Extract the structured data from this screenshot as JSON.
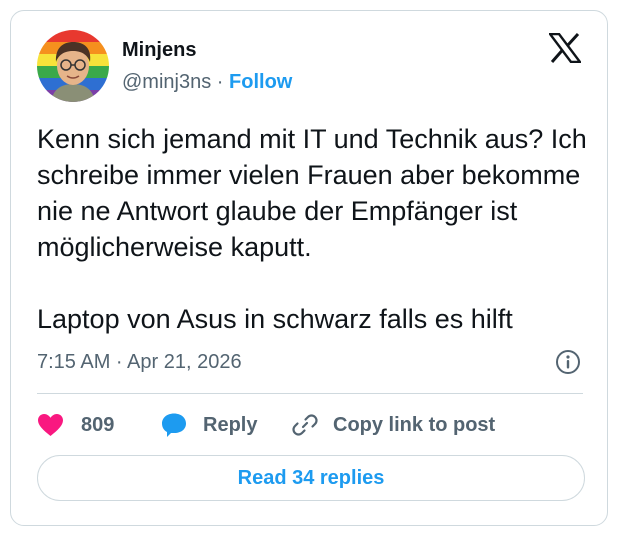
{
  "author": {
    "name": "Minjens",
    "handle": "@minj3ns",
    "separator": "·",
    "follow_label": "Follow"
  },
  "tweet": {
    "text": "Kenn sich jemand mit IT und Technik aus? Ich schreibe immer vielen Frauen aber bekomme nie ne Antwort glaube der Empfänger ist möglicherweise kaputt.\n\nLaptop von Asus in schwarz falls es hilft",
    "timestamp": "7:15 AM · Apr 21, 2026"
  },
  "actions": {
    "like_count": "809",
    "reply_label": "Reply",
    "copy_label": "Copy link to post"
  },
  "read_replies_label": "Read 34 replies",
  "icons": {
    "logo": "x-logo-icon",
    "info": "info-icon",
    "like": "heart-icon",
    "reply": "speech-bubble-icon",
    "copy": "link-icon"
  },
  "colors": {
    "accent": "#1d9bf0",
    "like": "#f91880",
    "secondary_text": "#536471",
    "border": "#cfd9de"
  }
}
